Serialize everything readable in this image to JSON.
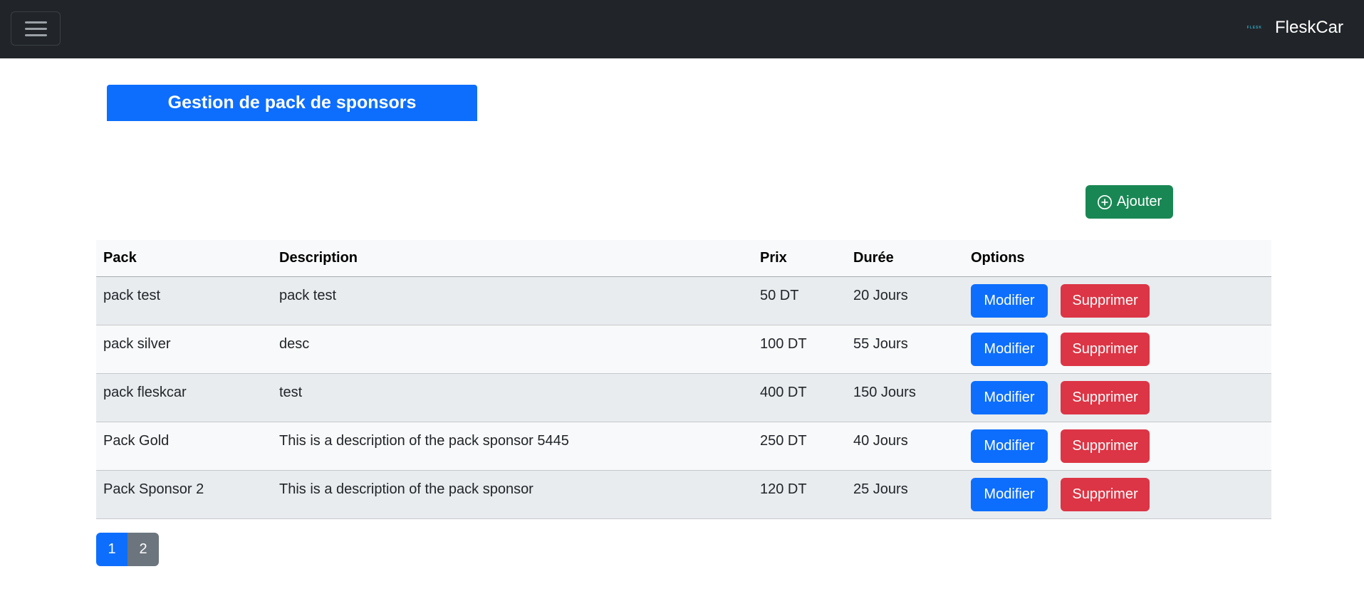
{
  "navbar": {
    "brand_logo_text": "FLESK",
    "brand_name": "FleskCar"
  },
  "header": {
    "title": "Gestion de pack de sponsors"
  },
  "actions": {
    "add_label": "Ajouter",
    "add_icon": "plus-circle-icon"
  },
  "table": {
    "columns": [
      "Pack",
      "Description",
      "Prix",
      "Durée",
      "Options"
    ],
    "rows": [
      {
        "pack": "pack test",
        "description": "pack test",
        "prix": "50 DT",
        "duree": "20 Jours",
        "modifier": "Modifier",
        "supprimer": "Supprimer"
      },
      {
        "pack": "pack silver",
        "description": "desc",
        "prix": "100 DT",
        "duree": "55 Jours",
        "modifier": "Modifier",
        "supprimer": "Supprimer"
      },
      {
        "pack": "pack fleskcar",
        "description": "test",
        "prix": "400 DT",
        "duree": "150 Jours",
        "modifier": "Modifier",
        "supprimer": "Supprimer"
      },
      {
        "pack": "Pack Gold",
        "description": "This is a description of the pack sponsor 5445",
        "prix": "250 DT",
        "duree": "40 Jours",
        "modifier": "Modifier",
        "supprimer": "Supprimer"
      },
      {
        "pack": "Pack Sponsor 2",
        "description": "This is a description of the pack sponsor",
        "prix": "120 DT",
        "duree": "25 Jours",
        "modifier": "Modifier",
        "supprimer": "Supprimer"
      }
    ]
  },
  "pagination": {
    "pages": [
      "1",
      "2"
    ],
    "active": "1"
  },
  "colors": {
    "navbar": "#212529",
    "primary": "#0d6efd",
    "success": "#198754",
    "danger": "#dc3545",
    "secondary": "#6c757d"
  }
}
